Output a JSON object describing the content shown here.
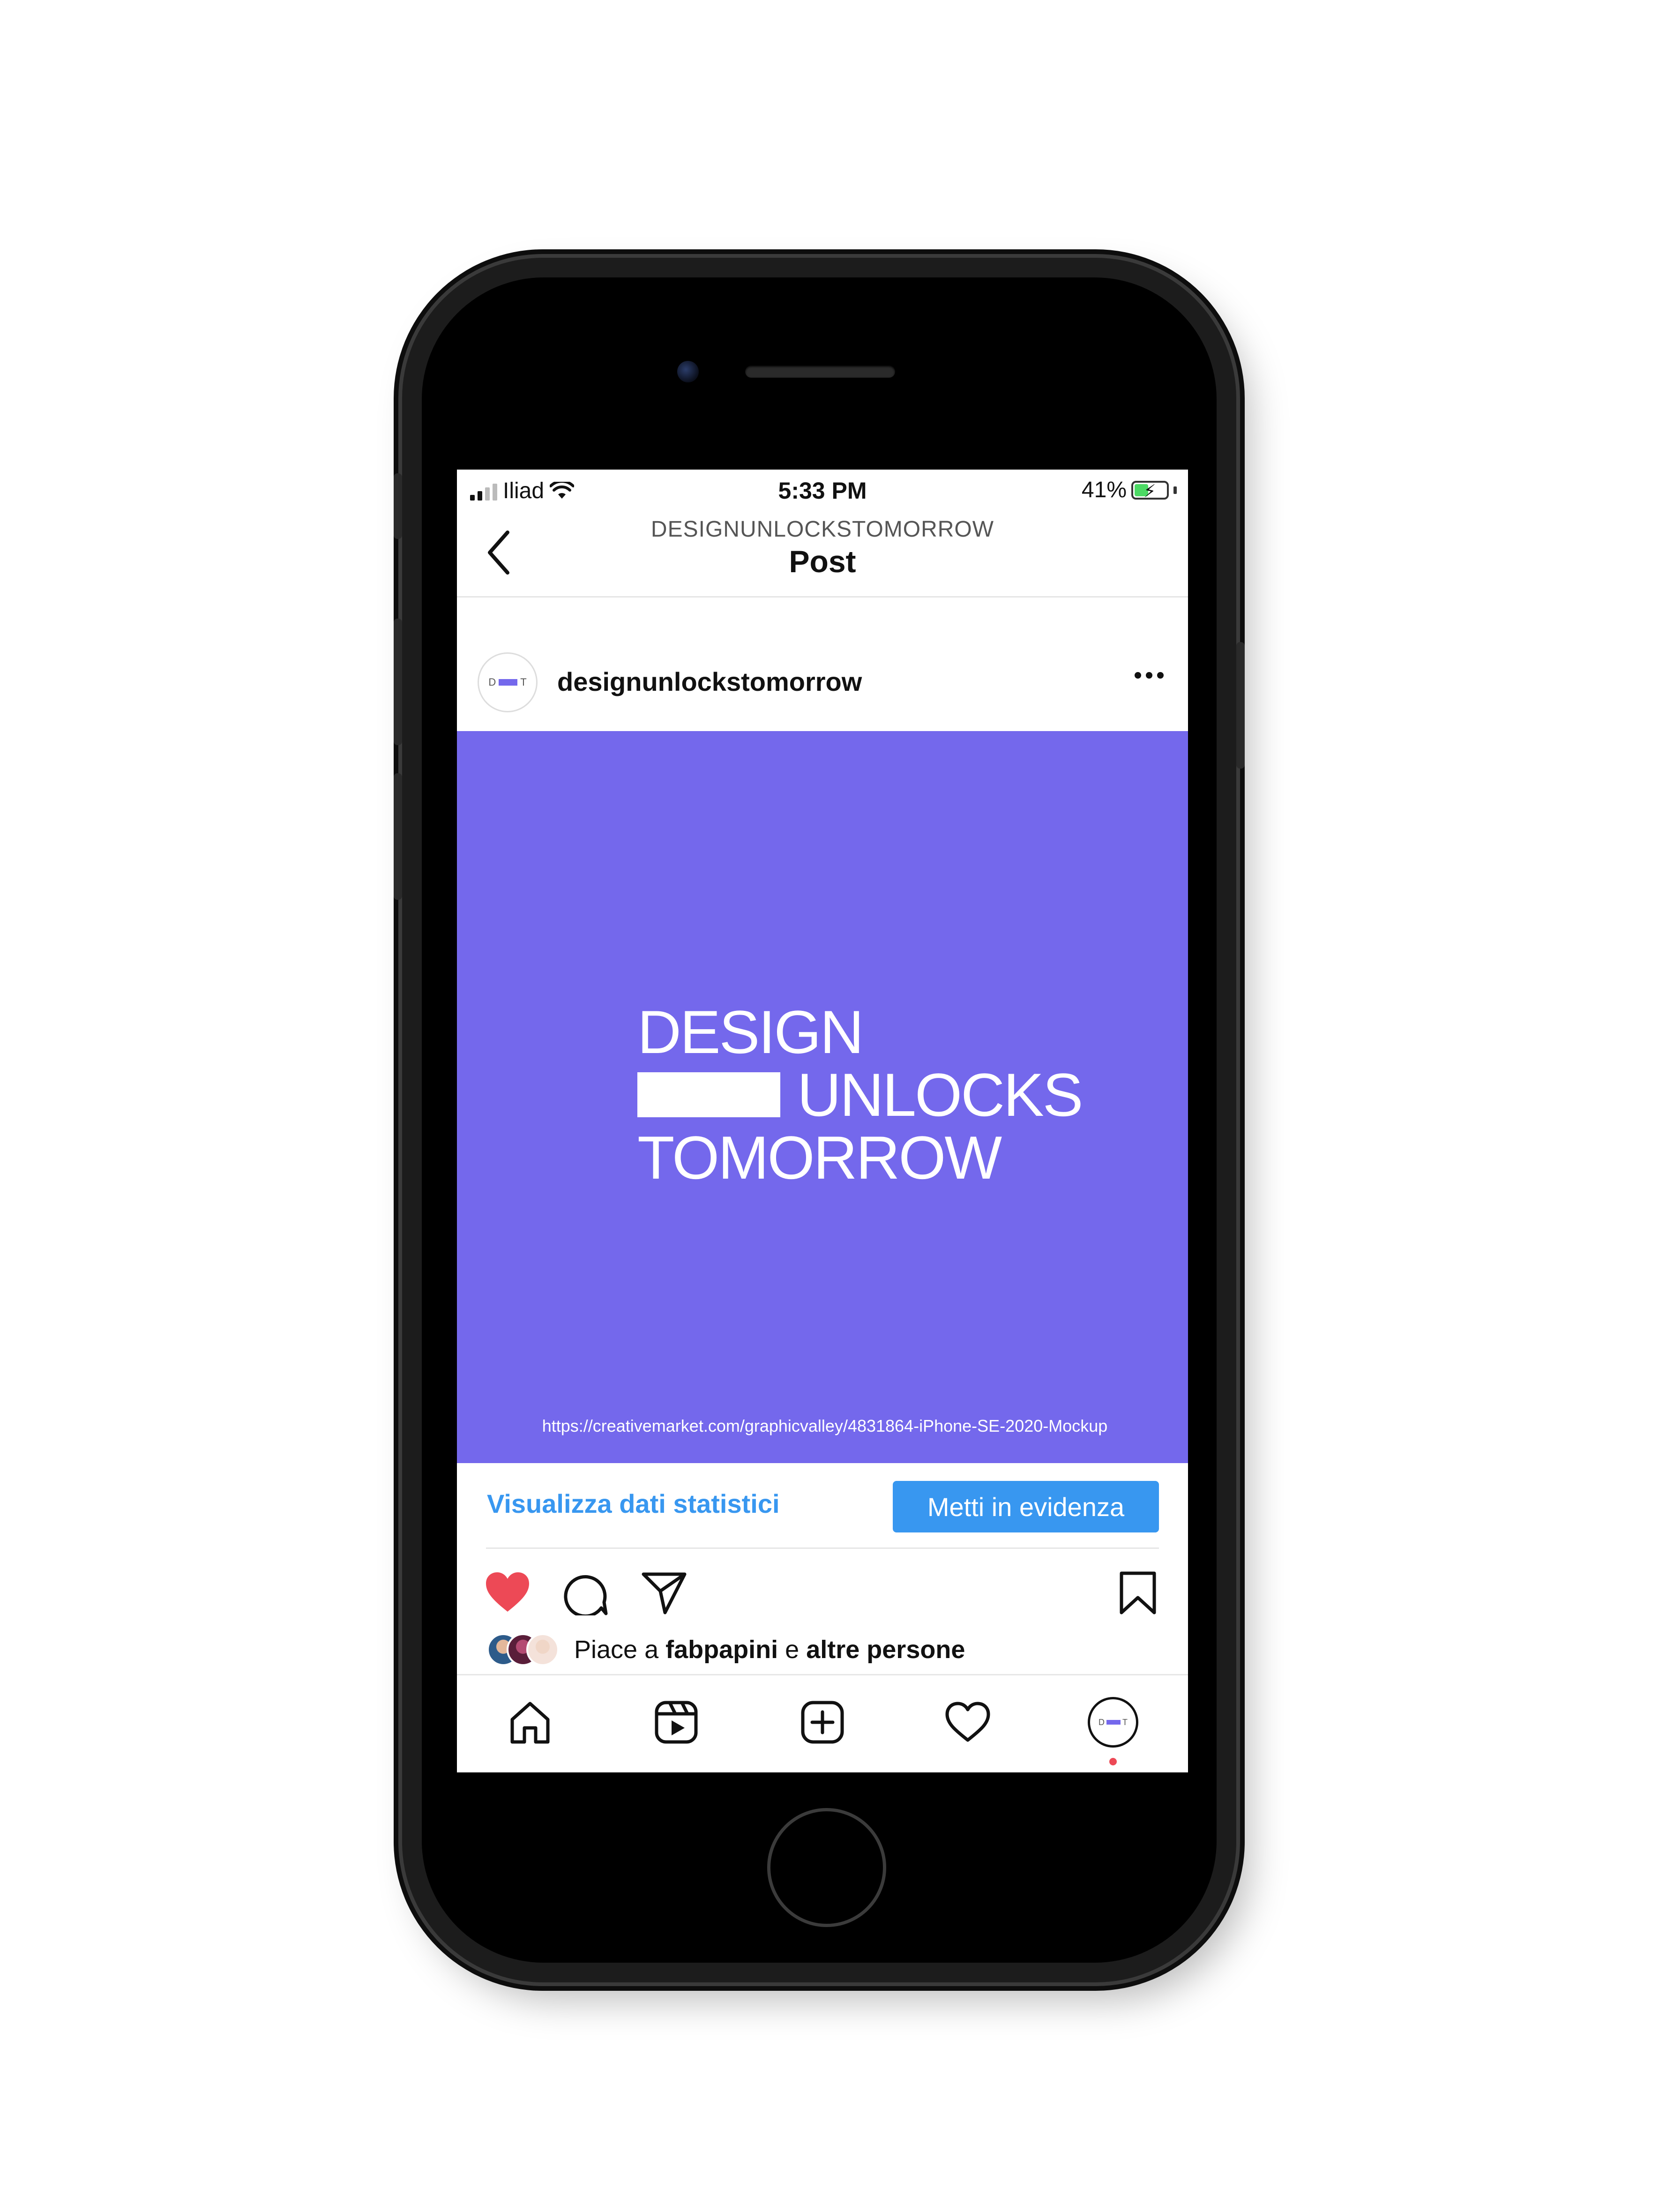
{
  "status_bar": {
    "carrier": "Iliad",
    "time": "5:33 PM",
    "battery": "41%"
  },
  "header": {
    "account": "DESIGNUNLOCKSTOMORROW",
    "title": "Post"
  },
  "post": {
    "avatar_left": "D",
    "avatar_right": "T",
    "username": "designunlockstomorrow",
    "image": {
      "background": "#7468EC",
      "line1": "DESIGN",
      "line2": "UNLOCKS",
      "line3": "TOMORROW",
      "url": "https://creativemarket.com/graphicvalley/4831864-iPhone-SE-2020-Mockup"
    },
    "insights_link": "Visualizza dati statistici",
    "promote_button": "Metti in evidenza",
    "likes": {
      "prefix": "Piace a",
      "user": "fabpapini",
      "conj": "e",
      "others": "altre persone"
    }
  },
  "icons": {
    "back": "chevron-left-icon",
    "more": "more-horizontal-icon",
    "like": "heart-filled-icon",
    "comment": "comment-icon",
    "share": "paper-plane-icon",
    "save": "bookmark-icon",
    "tabs": [
      "home-icon",
      "reels-icon",
      "add-post-icon",
      "activity-heart-icon",
      "profile-icon"
    ]
  },
  "colors": {
    "brand": "#7468EC",
    "link": "#3897f0",
    "like": "#ed4956"
  }
}
